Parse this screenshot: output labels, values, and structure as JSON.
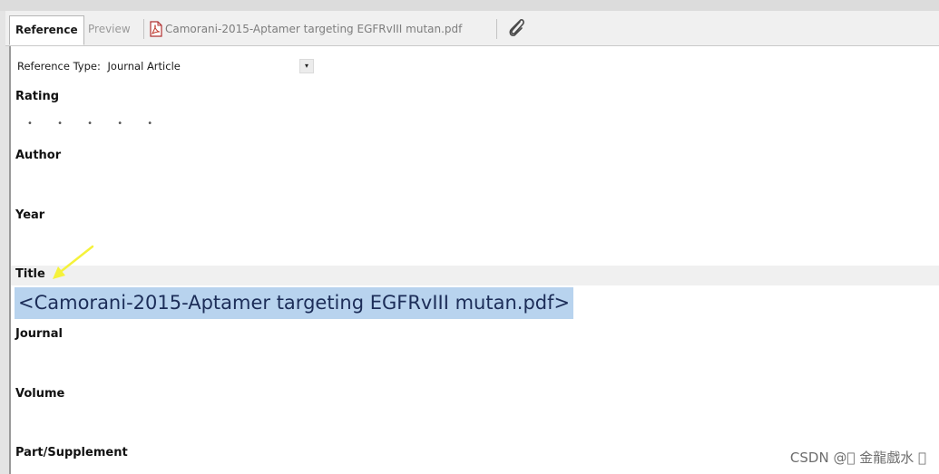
{
  "tabs": {
    "reference": "Reference",
    "preview": "Preview",
    "pdf": "Camorani-2015-Aptamer targeting EGFRvIII mutan.pdf"
  },
  "reference_type": {
    "label": "Reference Type:",
    "value": "Journal Article"
  },
  "fields": {
    "rating": "Rating",
    "rating_dots": "• • • • •",
    "author": "Author",
    "year": "Year",
    "title": "Title",
    "title_value": "<Camorani-2015-Aptamer targeting EGFRvIII mutan.pdf>",
    "journal": "Journal",
    "volume": "Volume",
    "part_supplement": "Part/Supplement"
  },
  "watermark": "CSDN @\u0000 金龍戲水 \u0000",
  "colors": {
    "title_highlight": "#b8d3ee",
    "arrow": "#f5f23a"
  },
  "icons": {
    "pdf": "pdf-file-icon",
    "attachment": "paperclip-icon",
    "dropdown": "dropdown-arrow-icon"
  }
}
